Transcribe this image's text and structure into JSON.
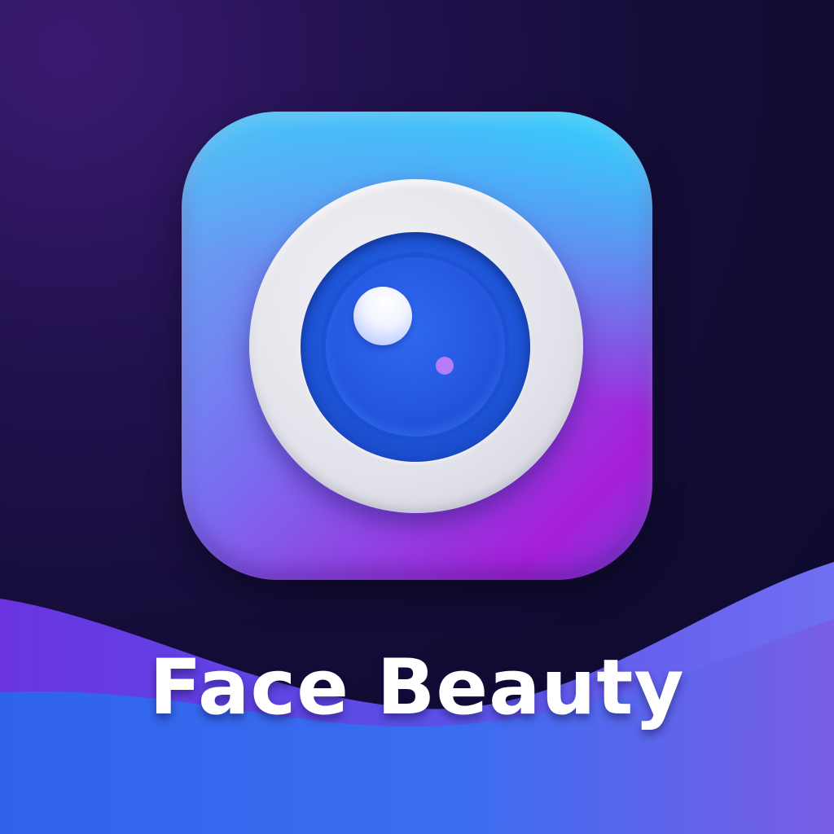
{
  "app": {
    "name": "Face Beauty",
    "icon": "camera-lens-icon"
  },
  "colors": {
    "background_dark": "#0f0b2e",
    "background_purple": "#3a1a72",
    "icon_cyan": "#30d6fc",
    "icon_magenta": "#a61fd8",
    "ring_gray": "#e2e2ea",
    "lens_blue": "#2457df",
    "lens_dot": "#b77cf5",
    "wave_blue": "#3a66ee",
    "title_text": "#ffffff"
  }
}
